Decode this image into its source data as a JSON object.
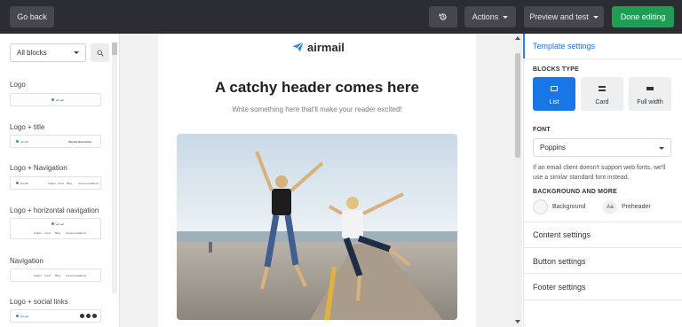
{
  "topbar": {
    "go_back": "Go back",
    "actions": "Actions",
    "preview": "Preview and test",
    "done": "Done editing"
  },
  "left_panel": {
    "filter_value": "All blocks",
    "blocks": [
      {
        "label": "Logo"
      },
      {
        "label": "Logo + title",
        "thumb_title": "Weekly Newsletter"
      },
      {
        "label": "Logo + Navigation"
      },
      {
        "label": "Logo + horizontal navigation"
      },
      {
        "label": "Navigation"
      },
      {
        "label": "Logo + social links"
      }
    ],
    "thumb_logo": "airmail",
    "thumb_nav": [
      "Higher",
      "Food",
      "Blog",
      "Accommodations"
    ]
  },
  "email": {
    "logo_text": "airmail",
    "headline": "A catchy header comes here",
    "subheadline": "Write something here that'll make your reader excited!"
  },
  "right_panel": {
    "template_settings": "Template settings",
    "blocks_type_heading": "BLOCKS TYPE",
    "block_types": [
      {
        "label": "List",
        "active": true,
        "icon": "list-layout-icon"
      },
      {
        "label": "Card",
        "active": false,
        "icon": "card-layout-icon"
      },
      {
        "label": "Full width",
        "active": false,
        "icon": "full-width-layout-icon"
      }
    ],
    "font_heading": "FONT",
    "font_value": "Poppins",
    "font_note": "If an email client doesn't support web fonts, we'll use a similar standard font instead.",
    "background_heading": "BACKGROUND AND MORE",
    "background_label": "Background",
    "preheader_label": "Preheader",
    "aa_glyph": "Aa",
    "content_settings": "Content settings",
    "button_settings": "Button settings",
    "footer_settings": "Footer settings"
  },
  "colors": {
    "topbar": "#2b2d30",
    "done_button": "#1f9d55",
    "accent": "#1976e6",
    "logo_blue": "#2d8de6"
  }
}
